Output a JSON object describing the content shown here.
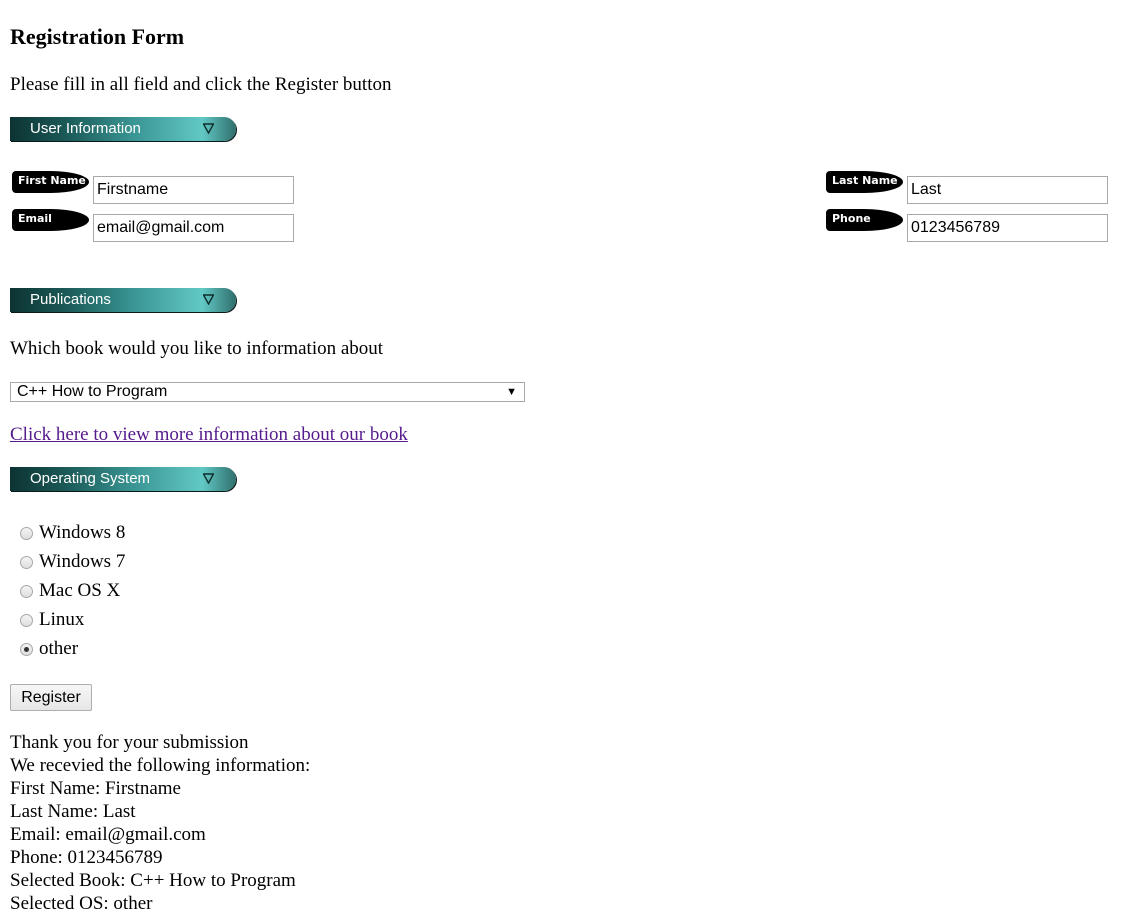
{
  "title": "Registration Form",
  "instructions": "Please fill in all field and click the Register button",
  "sections": {
    "user_info": "User Information",
    "publications": "Publications",
    "os": "Operating System"
  },
  "user_fields": {
    "first_name": {
      "label": "First Name",
      "value": "Firstname"
    },
    "last_name": {
      "label": "Last Name",
      "value": "Last"
    },
    "email": {
      "label": "Email",
      "value": "email@gmail.com"
    },
    "phone": {
      "label": "Phone",
      "value": "0123456789"
    }
  },
  "publications": {
    "question": "Which book would you like to information about",
    "selected_book": "C++ How to Program",
    "link_text": "Click here to view more information about our book"
  },
  "os_options": [
    {
      "label": "Windows 8",
      "checked": false
    },
    {
      "label": "Windows 7",
      "checked": false
    },
    {
      "label": "Mac OS X",
      "checked": false
    },
    {
      "label": "Linux",
      "checked": false
    },
    {
      "label": "other",
      "checked": true
    }
  ],
  "register_label": "Register",
  "result": {
    "thanks": "Thank you for your submission",
    "received": "We recevied the following information:",
    "first_name": "First Name: Firstname",
    "last_name": "Last Name: Last",
    "email": "Email: email@gmail.com",
    "phone": "Phone: 0123456789",
    "book": "Selected Book: C++ How to Program",
    "os": "Selected OS: other"
  },
  "colors": {
    "banner_dark": "#0c3332",
    "banner_light": "#62c8c4",
    "link_visited": "#551a8b"
  },
  "icons": {
    "banner_arrow": "triangle-down-icon",
    "select_arrow": "caret-down-icon"
  }
}
